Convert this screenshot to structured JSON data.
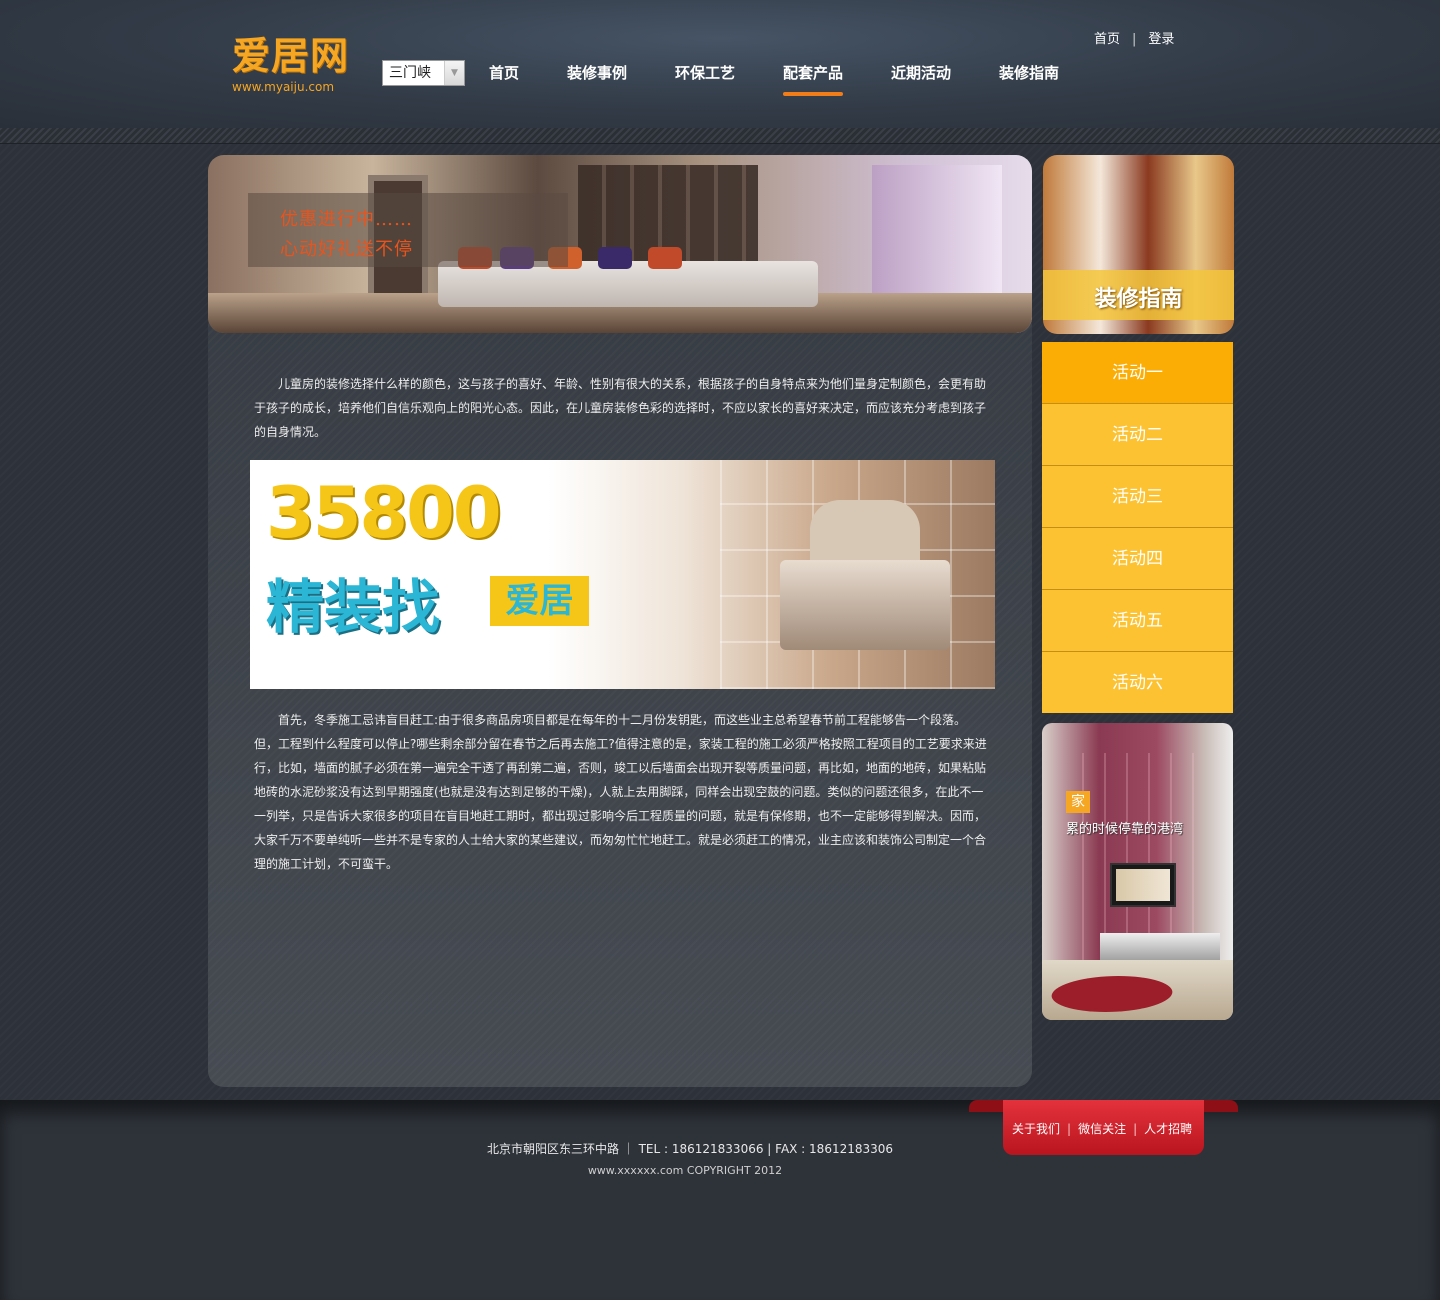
{
  "logo": {
    "main": "爱居网",
    "sub": "www.myaiju.com"
  },
  "city_select": {
    "value": "三门峡"
  },
  "nav": {
    "items": [
      {
        "label": "首页"
      },
      {
        "label": "装修事例"
      },
      {
        "label": "环保工艺"
      },
      {
        "label": "配套产品"
      },
      {
        "label": "近期活动"
      },
      {
        "label": "装修指南"
      }
    ],
    "active": "配套产品"
  },
  "top_links": {
    "home": "首页",
    "sep": "|",
    "login": "登录"
  },
  "banner": {
    "line1": "优惠进行中……",
    "line2": "心动好礼送不停"
  },
  "content": {
    "para1": "儿童房的装修选择什么样的颜色，这与孩子的喜好、年龄、性别有很大的关系，根据孩子的自身特点来为他们量身定制颜色，会更有助于孩子的成长，培养他们自信乐观向上的阳光心态。因此，在儿童房装修色彩的选择时，不应以家长的喜好来决定，而应该充分考虑到孩子的自身情况。",
    "para2": "首先，冬季施工忌讳盲目赶工:由于很多商品房项目都是在每年的十二月份发钥匙，而这些业主总希望春节前工程能够告一个段落。但，工程到什么程度可以停止?哪些剩余部分留在春节之后再去施工?值得注意的是，家装工程的施工必须严格按照工程项目的工艺要求来进行，比如，墙面的腻子必须在第一遍完全干透了再刮第二遍，否则，竣工以后墙面会出现开裂等质量问题，再比如，地面的地砖，如果粘贴地砖的水泥砂浆没有达到早期强度(也就是没有达到足够的干燥)，人就上去用脚踩，同样会出现空鼓的问题。类似的问题还很多，在此不一一列举，只是告诉大家很多的项目在盲目地赶工期时，都出现过影响今后工程质量的问题，就是有保修期，也不一定能够得到解决。因而，大家千万不要单纯听一些并不是专家的人士给大家的某些建议，而匆匆忙忙地赶工。就是必须赶工的情况，业主应该和装饰公司制定一个合理的施工计划，不可蛮干。"
  },
  "promo": {
    "number": "35800",
    "slogan": "精装找",
    "brand": "爱居"
  },
  "sidebar": {
    "banner_title": "装修指南",
    "activities": [
      {
        "label": "活动一",
        "active": true
      },
      {
        "label": "活动二",
        "active": false
      },
      {
        "label": "活动三",
        "active": false
      },
      {
        "label": "活动四",
        "active": false
      },
      {
        "label": "活动五",
        "active": false
      },
      {
        "label": "活动六",
        "active": false
      }
    ],
    "photo_badge": "家",
    "photo_caption": "累的时候停靠的港湾"
  },
  "footer": {
    "links": [
      "关于我们",
      "微信关注",
      "人才招聘"
    ],
    "sep": "|",
    "address": "北京市朝阳区东三环中路 ｜ TEL : 186121833066 | FAX : 18612183306",
    "copyright": "www.xxxxxx.com COPYRIGHT 2012"
  },
  "colors": {
    "accent": "#f5a623",
    "activity_bg": "#fcc232",
    "activity_active": "#fcad05",
    "footer_red": "#d9222d",
    "nav_underline": "#f07d1a"
  }
}
